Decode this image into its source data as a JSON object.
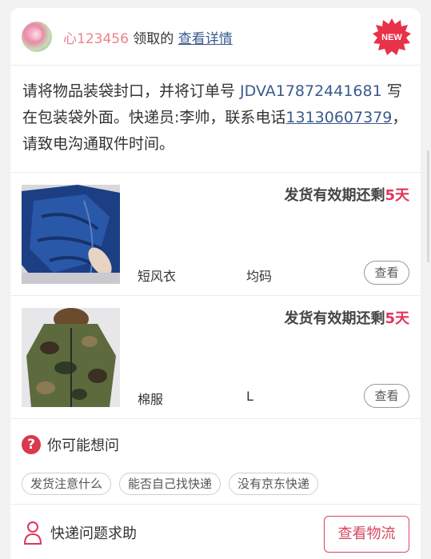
{
  "header": {
    "user": "心123456",
    "claimed_text": " 领取的 ",
    "details_link": "查看详情",
    "badge": "NEW"
  },
  "notice": {
    "part1": "请将物品装袋封口，并将订单号 ",
    "order_no": "JDVA17872441681",
    "part2": " 写在包装袋外面。快递员:李帅，联系电话",
    "phone": "13130607379",
    "part3": "，请致电沟通取件时间。"
  },
  "items": [
    {
      "deadline_prefix": "发货有效期还剩",
      "deadline_days": "5天",
      "name": "短风衣",
      "size": "均码",
      "view_label": "查看",
      "thumb_icon": "blue-fleece-coat-photo"
    },
    {
      "deadline_prefix": "发货有效期还剩",
      "deadline_days": "5天",
      "name": "棉服",
      "size": "L",
      "view_label": "查看",
      "thumb_icon": "camo-jacket-photo"
    }
  ],
  "faq": {
    "icon": "question-icon",
    "title": "你可能想问",
    "chips": [
      "发货注意什么",
      "能否自己找快递",
      "没有京东快递"
    ]
  },
  "help": {
    "icon": "person-icon",
    "label": "快递问题求助",
    "track_button": "查看物流"
  },
  "colors": {
    "accent": "#e0365c",
    "link": "#3a5a8c",
    "username": "#e8848c",
    "button_border": "#d6485f"
  }
}
